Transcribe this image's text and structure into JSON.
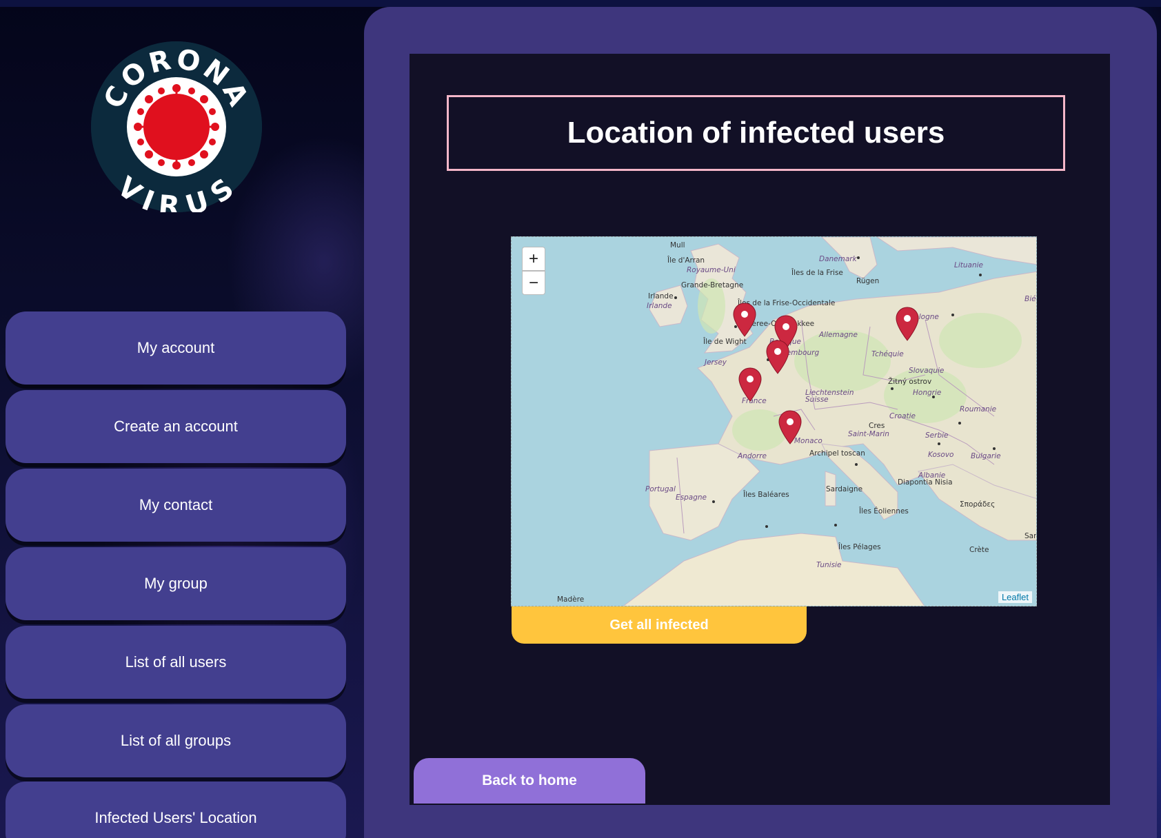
{
  "logo": {
    "top_text": "CORONA",
    "bottom_text": "VIRUS",
    "icon": "coronavirus-logo-icon"
  },
  "sidebar": {
    "items": [
      {
        "label": "My account"
      },
      {
        "label": "Create an account"
      },
      {
        "label": "My contact"
      },
      {
        "label": "My group"
      },
      {
        "label": "List of all users"
      },
      {
        "label": "List of all groups"
      },
      {
        "label": "Infected Users' Location"
      }
    ]
  },
  "main": {
    "title": "Location of infected users",
    "map": {
      "zoom_in": "+",
      "zoom_out": "−",
      "attribution": "Leaflet",
      "marker_icon": "map-marker-icon",
      "marker_count": 6,
      "labels": [
        "Mull",
        "Île d'Arran",
        "Royaume-Uni",
        "Grande-Bretagne",
        "Irlande",
        "Irlande",
        "Danemark",
        "Îles de la Frise",
        "Rügen",
        "Lituanie",
        "Îles de la Frise-Occidentale",
        "Goeree-Overflakkee",
        "Allemagne",
        "Pologne",
        "Île de Wight",
        "Belgique",
        "Luxembourg",
        "Tchéquie",
        "Jersey",
        "Slovaquie",
        "Žitný ostrov",
        "Hongrie",
        "Liechtenstein",
        "Suisse",
        "France",
        "Croatie",
        "Roumanie",
        "Cres",
        "Saint-Marin",
        "Serbie",
        "Monaco",
        "Archipel toscan",
        "Kosovo",
        "Bulgarie",
        "Andorre",
        "Albanie",
        "Diapontia Nisia",
        "Portugal",
        "Espagne",
        "Îles Baléares",
        "Sardaigne",
        "Σποράδες",
        "Îles Éoliennes",
        "Îles Pélages",
        "Crète",
        "Tunisie",
        "Madère",
        "Bié",
        "Sam"
      ]
    },
    "get_infected_label": "Get all infected",
    "back_home_label": "Back to home"
  },
  "colors": {
    "nav_button": "#433f8f",
    "card": "#3e367d",
    "panel": "#121026",
    "title_border": "#f4b6c8",
    "get_infected": "#ffc53d",
    "back_home": "#9070d8",
    "marker": "#cc2840",
    "sea": "#aad3df",
    "land": "#eae6d8"
  }
}
